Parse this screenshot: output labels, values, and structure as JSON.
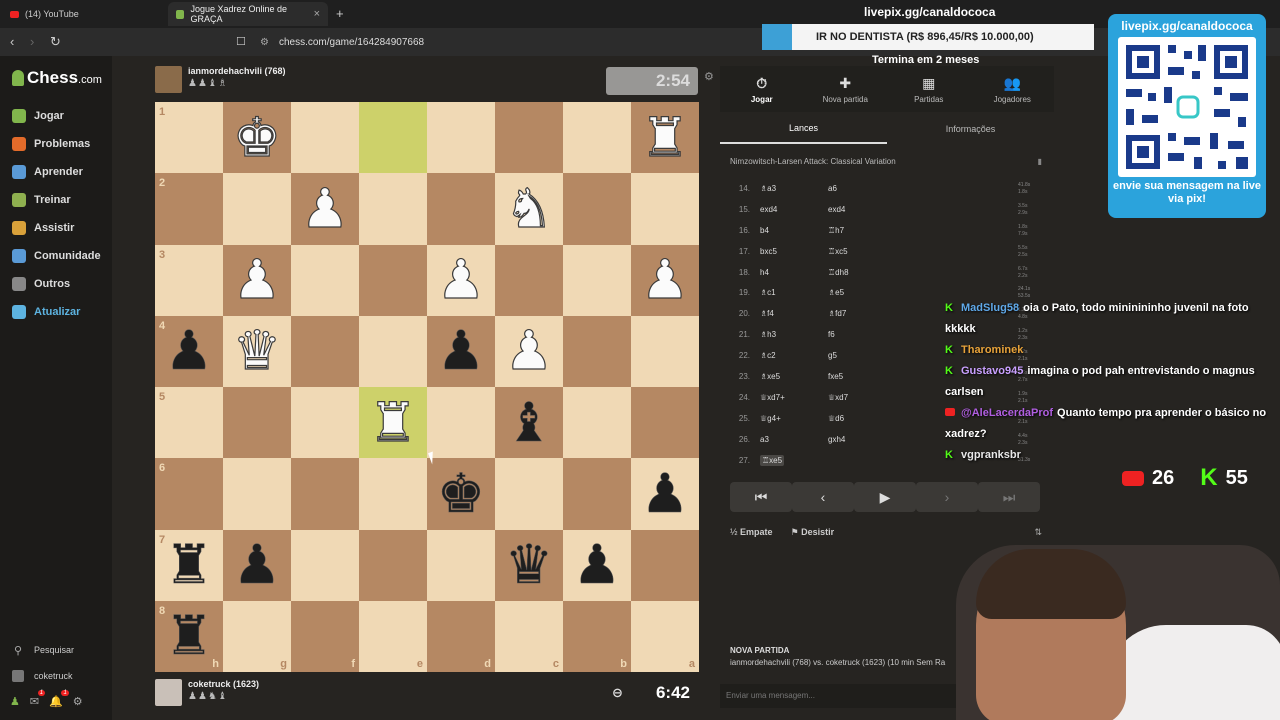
{
  "browser": {
    "tabs": [
      {
        "label": "(14) YouTube"
      },
      {
        "label": "Jogue Xadrez Online de GRAÇA"
      }
    ],
    "url": "chess.com/game/164284907668"
  },
  "sidebar": {
    "logo_main": "Chess",
    "logo_suffix": ".com",
    "items": [
      {
        "label": "Jogar",
        "color": "#81b64c"
      },
      {
        "label": "Problemas",
        "color": "#e36b2a"
      },
      {
        "label": "Aprender",
        "color": "#5a9ad6"
      },
      {
        "label": "Treinar",
        "color": "#8fb04f"
      },
      {
        "label": "Assistir",
        "color": "#d9a13a"
      },
      {
        "label": "Comunidade",
        "color": "#5a9ad6"
      },
      {
        "label": "Outros",
        "color": "#888888"
      },
      {
        "label": "Atualizar",
        "color": "#5db3e0"
      }
    ],
    "search_label": "Pesquisar",
    "user_label": "coketruck",
    "badges": [
      "1",
      "1"
    ]
  },
  "game": {
    "top_player": {
      "name": "ianmordehachvili (768)",
      "captured": "♟♟♝♗",
      "clock": "2:54"
    },
    "bottom_player": {
      "name": "coketruck (1623)",
      "captured": "♟♟♞♝",
      "clock": "6:42"
    },
    "ranks": [
      "1",
      "2",
      "3",
      "4",
      "5",
      "6",
      "7",
      "8"
    ],
    "files": [
      "h",
      "g",
      "f",
      "e",
      "d",
      "c",
      "b",
      "a"
    ],
    "highlights": [
      [
        0,
        3
      ],
      [
        4,
        3
      ]
    ],
    "pieces": [
      {
        "row": 0,
        "col": 1,
        "glyph": "♚",
        "color": "w",
        "name": "white-king"
      },
      {
        "row": 0,
        "col": 7,
        "glyph": "♜",
        "color": "w",
        "name": "white-rook"
      },
      {
        "row": 1,
        "col": 2,
        "glyph": "♟",
        "color": "w",
        "name": "white-pawn"
      },
      {
        "row": 1,
        "col": 5,
        "glyph": "♞",
        "color": "w",
        "name": "white-knight"
      },
      {
        "row": 2,
        "col": 1,
        "glyph": "♟",
        "color": "w",
        "name": "white-pawn"
      },
      {
        "row": 2,
        "col": 4,
        "glyph": "♟",
        "color": "w",
        "name": "white-pawn"
      },
      {
        "row": 2,
        "col": 7,
        "glyph": "♟",
        "color": "w",
        "name": "white-pawn"
      },
      {
        "row": 3,
        "col": 0,
        "glyph": "♟",
        "color": "b",
        "name": "black-pawn"
      },
      {
        "row": 3,
        "col": 1,
        "glyph": "♛",
        "color": "w",
        "name": "white-queen"
      },
      {
        "row": 3,
        "col": 4,
        "glyph": "♟",
        "color": "b",
        "name": "black-pawn"
      },
      {
        "row": 3,
        "col": 5,
        "glyph": "♟",
        "color": "w",
        "name": "white-pawn"
      },
      {
        "row": 4,
        "col": 3,
        "glyph": "♜",
        "color": "w",
        "name": "white-rook"
      },
      {
        "row": 4,
        "col": 5,
        "glyph": "♝",
        "color": "b",
        "name": "black-bishop"
      },
      {
        "row": 5,
        "col": 4,
        "glyph": "♚",
        "color": "b",
        "name": "black-king"
      },
      {
        "row": 5,
        "col": 7,
        "glyph": "♟",
        "color": "b",
        "name": "black-pawn"
      },
      {
        "row": 6,
        "col": 0,
        "glyph": "♜",
        "color": "b",
        "name": "black-rook"
      },
      {
        "row": 6,
        "col": 1,
        "glyph": "♟",
        "color": "b",
        "name": "black-pawn"
      },
      {
        "row": 6,
        "col": 5,
        "glyph": "♛",
        "color": "b",
        "name": "black-queen"
      },
      {
        "row": 6,
        "col": 6,
        "glyph": "♟",
        "color": "b",
        "name": "black-pawn"
      },
      {
        "row": 7,
        "col": 0,
        "glyph": "♜",
        "color": "b",
        "name": "black-rook"
      }
    ]
  },
  "panel": {
    "tabs": [
      {
        "label": "Jogar",
        "icon": "⏱"
      },
      {
        "label": "Nova partida",
        "icon": "✚"
      },
      {
        "label": "Partidas",
        "icon": "▦"
      },
      {
        "label": "Jogadores",
        "icon": "👥"
      }
    ],
    "subtabs": [
      "Lances",
      "Informações"
    ],
    "opening": "Nimzowitsch-Larsen Attack: Classical Variation",
    "moves": [
      {
        "n": "14.",
        "w": "♗a3",
        "b": "a6",
        "tw": "41.8s",
        "tb": "1.8s"
      },
      {
        "n": "15.",
        "w": "exd4",
        "b": "exd4",
        "tw": "3.5s",
        "tb": "2.9s"
      },
      {
        "n": "16.",
        "w": "b4",
        "b": "♖h7",
        "tw": "1.8s",
        "tb": "7.9s"
      },
      {
        "n": "17.",
        "w": "bxc5",
        "b": "♖xc5",
        "tw": "5.5s",
        "tb": "2.5s"
      },
      {
        "n": "18.",
        "w": "h4",
        "b": "♖dh8",
        "tw": "6.7s",
        "tb": "2.2s"
      },
      {
        "n": "19.",
        "w": "♗c1",
        "b": "♗e5",
        "tw": "24.1s",
        "tb": "53.5s"
      },
      {
        "n": "20.",
        "w": "♗f4",
        "b": "♗fd7",
        "tw": "1.2s",
        "tb": "4.8s"
      },
      {
        "n": "21.",
        "w": "♗h3",
        "b": "f6",
        "tw": "1.2s",
        "tb": "2.3s"
      },
      {
        "n": "22.",
        "w": "♗c2",
        "b": "g5",
        "tw": "1.2s",
        "tb": "2.1s"
      },
      {
        "n": "23.",
        "w": "♗xe5",
        "b": "fxe5",
        "tw": "1.6s",
        "tb": "2.7s"
      },
      {
        "n": "24.",
        "w": "♕xd7+",
        "b": "♕xd7",
        "tw": "1.9s",
        "tb": "2.1s"
      },
      {
        "n": "25.",
        "w": "♕g4+",
        "b": "♕d6",
        "tw": "2.1s",
        "tb": "2.1s"
      },
      {
        "n": "26.",
        "w": "a3",
        "b": "gxh4",
        "tw": "4.4s",
        "tb": "2.3s"
      },
      {
        "n": "27.",
        "w": "♖xe5",
        "b": "",
        "tw": "31.3s",
        "tb": ""
      }
    ],
    "draw_label": "Empate",
    "resign_label": "Desistir",
    "newgame_title": "NOVA PARTIDA",
    "newgame_text": "ianmordehachvili (768) vs. coketruck (1623) (10 min Sem Ra",
    "message_placeholder": "Enviar uma mensagem..."
  },
  "overlay": {
    "goal_title": "livepix.gg/canaldococa",
    "goal_text": "IR NO DENTISTA (R$ 896,45/R$ 10.000,00)",
    "goal_progress": 0.09,
    "goal_subtitle": "Termina em 2 meses",
    "qr_header": "livepix.gg/canaldococa",
    "qr_footer": "envie sua mensagem na live via pix!",
    "chat": [
      {
        "src": "kick",
        "user": "MadSlug58",
        "msg": "oia o Pato, todo mininininho juvenil na foto kkkkk",
        "color": "#5fa8e8"
      },
      {
        "src": "kick",
        "user": "Tharominek",
        "msg": "",
        "color": "#e8a33a"
      },
      {
        "src": "kick",
        "user": "Gustavo945",
        "msg": "imagina o pod pah entrevistando o magnus carlsen",
        "color": "#c9a0ff"
      },
      {
        "src": "yt",
        "user": "@AleLacerdaProf",
        "msg": "Quanto tempo pra aprender o básico no xadrez?",
        "color": "#b05ee0"
      },
      {
        "src": "kick",
        "user": "vgpranksbr",
        "msg": "",
        "color": "#e8e8e8"
      }
    ],
    "youtube_count": "26",
    "kick_count": "55"
  }
}
